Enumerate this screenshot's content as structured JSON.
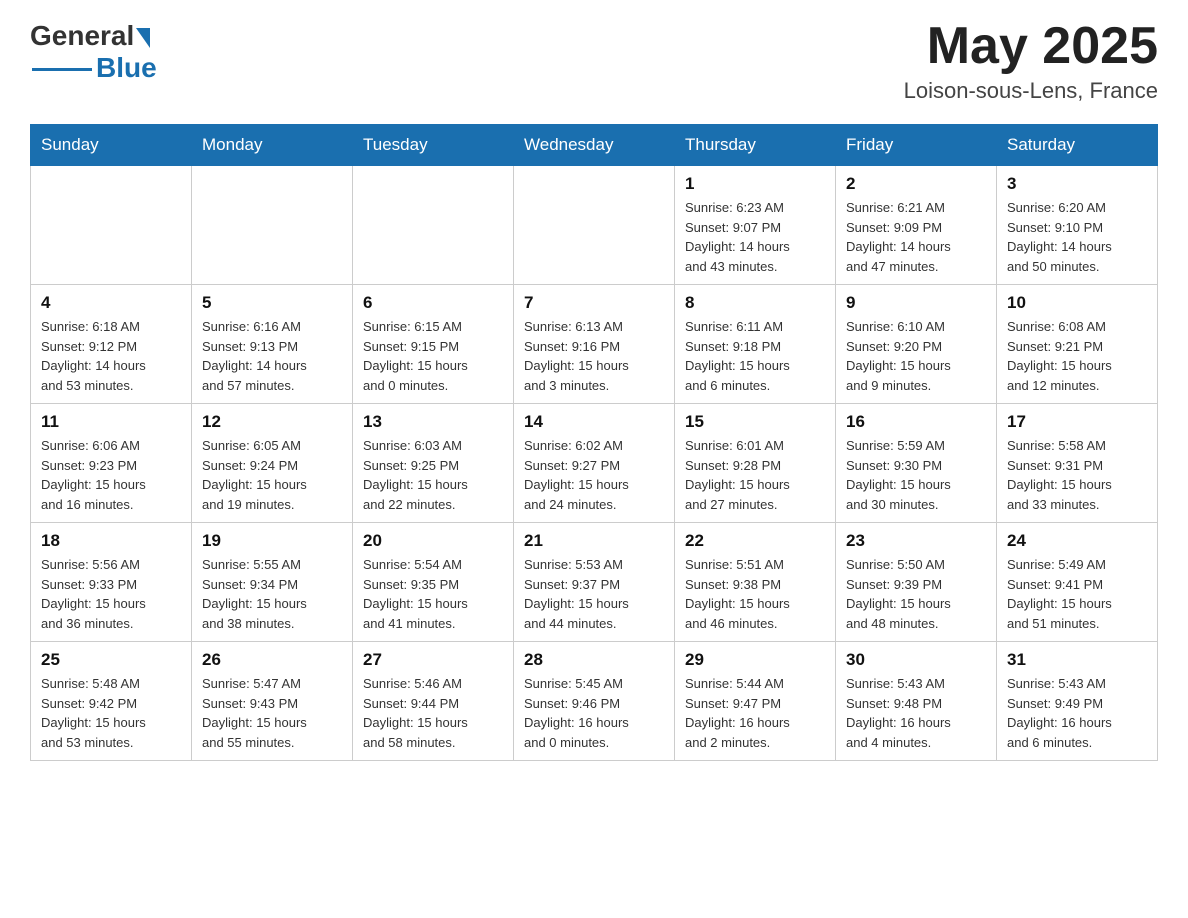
{
  "header": {
    "logo_general": "General",
    "logo_blue": "Blue",
    "month_title": "May 2025",
    "location": "Loison-sous-Lens, France"
  },
  "weekdays": [
    "Sunday",
    "Monday",
    "Tuesday",
    "Wednesday",
    "Thursday",
    "Friday",
    "Saturday"
  ],
  "weeks": [
    [
      {
        "day": "",
        "info": ""
      },
      {
        "day": "",
        "info": ""
      },
      {
        "day": "",
        "info": ""
      },
      {
        "day": "",
        "info": ""
      },
      {
        "day": "1",
        "info": "Sunrise: 6:23 AM\nSunset: 9:07 PM\nDaylight: 14 hours\nand 43 minutes."
      },
      {
        "day": "2",
        "info": "Sunrise: 6:21 AM\nSunset: 9:09 PM\nDaylight: 14 hours\nand 47 minutes."
      },
      {
        "day": "3",
        "info": "Sunrise: 6:20 AM\nSunset: 9:10 PM\nDaylight: 14 hours\nand 50 minutes."
      }
    ],
    [
      {
        "day": "4",
        "info": "Sunrise: 6:18 AM\nSunset: 9:12 PM\nDaylight: 14 hours\nand 53 minutes."
      },
      {
        "day": "5",
        "info": "Sunrise: 6:16 AM\nSunset: 9:13 PM\nDaylight: 14 hours\nand 57 minutes."
      },
      {
        "day": "6",
        "info": "Sunrise: 6:15 AM\nSunset: 9:15 PM\nDaylight: 15 hours\nand 0 minutes."
      },
      {
        "day": "7",
        "info": "Sunrise: 6:13 AM\nSunset: 9:16 PM\nDaylight: 15 hours\nand 3 minutes."
      },
      {
        "day": "8",
        "info": "Sunrise: 6:11 AM\nSunset: 9:18 PM\nDaylight: 15 hours\nand 6 minutes."
      },
      {
        "day": "9",
        "info": "Sunrise: 6:10 AM\nSunset: 9:20 PM\nDaylight: 15 hours\nand 9 minutes."
      },
      {
        "day": "10",
        "info": "Sunrise: 6:08 AM\nSunset: 9:21 PM\nDaylight: 15 hours\nand 12 minutes."
      }
    ],
    [
      {
        "day": "11",
        "info": "Sunrise: 6:06 AM\nSunset: 9:23 PM\nDaylight: 15 hours\nand 16 minutes."
      },
      {
        "day": "12",
        "info": "Sunrise: 6:05 AM\nSunset: 9:24 PM\nDaylight: 15 hours\nand 19 minutes."
      },
      {
        "day": "13",
        "info": "Sunrise: 6:03 AM\nSunset: 9:25 PM\nDaylight: 15 hours\nand 22 minutes."
      },
      {
        "day": "14",
        "info": "Sunrise: 6:02 AM\nSunset: 9:27 PM\nDaylight: 15 hours\nand 24 minutes."
      },
      {
        "day": "15",
        "info": "Sunrise: 6:01 AM\nSunset: 9:28 PM\nDaylight: 15 hours\nand 27 minutes."
      },
      {
        "day": "16",
        "info": "Sunrise: 5:59 AM\nSunset: 9:30 PM\nDaylight: 15 hours\nand 30 minutes."
      },
      {
        "day": "17",
        "info": "Sunrise: 5:58 AM\nSunset: 9:31 PM\nDaylight: 15 hours\nand 33 minutes."
      }
    ],
    [
      {
        "day": "18",
        "info": "Sunrise: 5:56 AM\nSunset: 9:33 PM\nDaylight: 15 hours\nand 36 minutes."
      },
      {
        "day": "19",
        "info": "Sunrise: 5:55 AM\nSunset: 9:34 PM\nDaylight: 15 hours\nand 38 minutes."
      },
      {
        "day": "20",
        "info": "Sunrise: 5:54 AM\nSunset: 9:35 PM\nDaylight: 15 hours\nand 41 minutes."
      },
      {
        "day": "21",
        "info": "Sunrise: 5:53 AM\nSunset: 9:37 PM\nDaylight: 15 hours\nand 44 minutes."
      },
      {
        "day": "22",
        "info": "Sunrise: 5:51 AM\nSunset: 9:38 PM\nDaylight: 15 hours\nand 46 minutes."
      },
      {
        "day": "23",
        "info": "Sunrise: 5:50 AM\nSunset: 9:39 PM\nDaylight: 15 hours\nand 48 minutes."
      },
      {
        "day": "24",
        "info": "Sunrise: 5:49 AM\nSunset: 9:41 PM\nDaylight: 15 hours\nand 51 minutes."
      }
    ],
    [
      {
        "day": "25",
        "info": "Sunrise: 5:48 AM\nSunset: 9:42 PM\nDaylight: 15 hours\nand 53 minutes."
      },
      {
        "day": "26",
        "info": "Sunrise: 5:47 AM\nSunset: 9:43 PM\nDaylight: 15 hours\nand 55 minutes."
      },
      {
        "day": "27",
        "info": "Sunrise: 5:46 AM\nSunset: 9:44 PM\nDaylight: 15 hours\nand 58 minutes."
      },
      {
        "day": "28",
        "info": "Sunrise: 5:45 AM\nSunset: 9:46 PM\nDaylight: 16 hours\nand 0 minutes."
      },
      {
        "day": "29",
        "info": "Sunrise: 5:44 AM\nSunset: 9:47 PM\nDaylight: 16 hours\nand 2 minutes."
      },
      {
        "day": "30",
        "info": "Sunrise: 5:43 AM\nSunset: 9:48 PM\nDaylight: 16 hours\nand 4 minutes."
      },
      {
        "day": "31",
        "info": "Sunrise: 5:43 AM\nSunset: 9:49 PM\nDaylight: 16 hours\nand 6 minutes."
      }
    ]
  ]
}
